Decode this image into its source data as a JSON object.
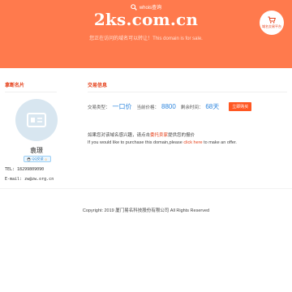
{
  "hero": {
    "whois_label": "whois查询",
    "domain": "2ks.com.cn",
    "sale_text": "您正在访问的域名可以转让！This domain is for sale.",
    "seal_text": "域名交易平台"
  },
  "profile": {
    "section_title": "拿断名片",
    "name": "袁璟",
    "qq_badge": "QQ交谈",
    "tel": "TEL: 18299809090",
    "email": "E-mail: zw@zw.org.cn"
  },
  "trade": {
    "section_title": "交易信息",
    "type_label": "交易类型：",
    "type_value": "一口价",
    "price_label": "当前价格：",
    "price_value": "8800",
    "remaining_label": "剩余时间：",
    "remaining_value": "68天",
    "buy_button": "立即购买",
    "note_cn_prefix": "如果您对该域名感兴趣，请点击",
    "note_cn_link": "委托卖家",
    "note_cn_suffix": "提供您的报价",
    "note_en_prefix": "If you would like to purchase this domain,please",
    "note_en_link": "click here",
    "note_en_suffix": "to make an offer."
  },
  "footer": {
    "copyright": "Copyright: 2019 厦门易名科技股份有限公司 All Rights Reserved"
  },
  "icons": {
    "whois": "search-icon",
    "seal": "cart-icon",
    "avatar": "id-card-icon",
    "qq": "qq-icon"
  },
  "colors": {
    "brand": "#ff7a4d",
    "accent": "#e5411b",
    "value_blue": "#2e86de",
    "buy_button": "#ff5722"
  }
}
